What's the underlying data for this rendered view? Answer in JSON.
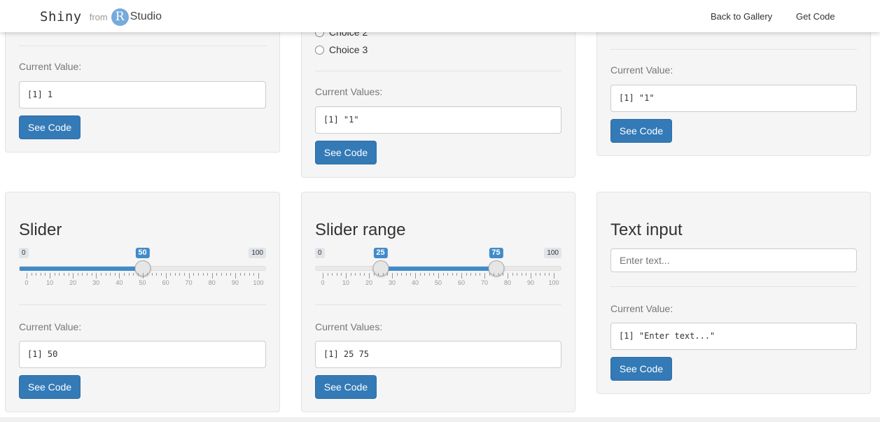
{
  "navbar": {
    "brand_shiny": "Shiny",
    "brand_from": "from",
    "brand_r": "R",
    "brand_studio": "Studio",
    "back_to_gallery": "Back to Gallery",
    "get_code": "Get Code"
  },
  "panel_top_left": {
    "label": "Current Value:",
    "output": "[1] 1",
    "button": "See Code"
  },
  "panel_top_middle": {
    "choice2": "Choice 2",
    "choice3": "Choice 3",
    "label": "Current Values:",
    "output": "[1] \"1\"",
    "button": "See Code"
  },
  "panel_top_right": {
    "label": "Current Value:",
    "output": "[1] \"1\"",
    "button": "See Code"
  },
  "slider_panel": {
    "title": "Slider",
    "min": "0",
    "max": "100",
    "value": 50,
    "value_label": "50",
    "ticks": [
      "0",
      "10",
      "20",
      "30",
      "40",
      "50",
      "60",
      "70",
      "80",
      "90",
      "100"
    ],
    "label": "Current Value:",
    "output": "[1] 50",
    "button": "See Code"
  },
  "slider_range_panel": {
    "title": "Slider range",
    "min": "0",
    "max": "100",
    "from": 25,
    "to": 75,
    "from_label": "25",
    "to_label": "75",
    "ticks": [
      "0",
      "10",
      "20",
      "30",
      "40",
      "50",
      "60",
      "70",
      "80",
      "90",
      "100"
    ],
    "label": "Current Values:",
    "output": "[1] 25 75",
    "button": "See Code"
  },
  "text_input_panel": {
    "title": "Text input",
    "placeholder": "Enter text...",
    "label": "Current Value:",
    "output": "[1] \"Enter text...\"",
    "button": "See Code"
  },
  "colors": {
    "accent": "#337ab7",
    "slider": "#428bca",
    "r_logo": "#75aadb"
  }
}
